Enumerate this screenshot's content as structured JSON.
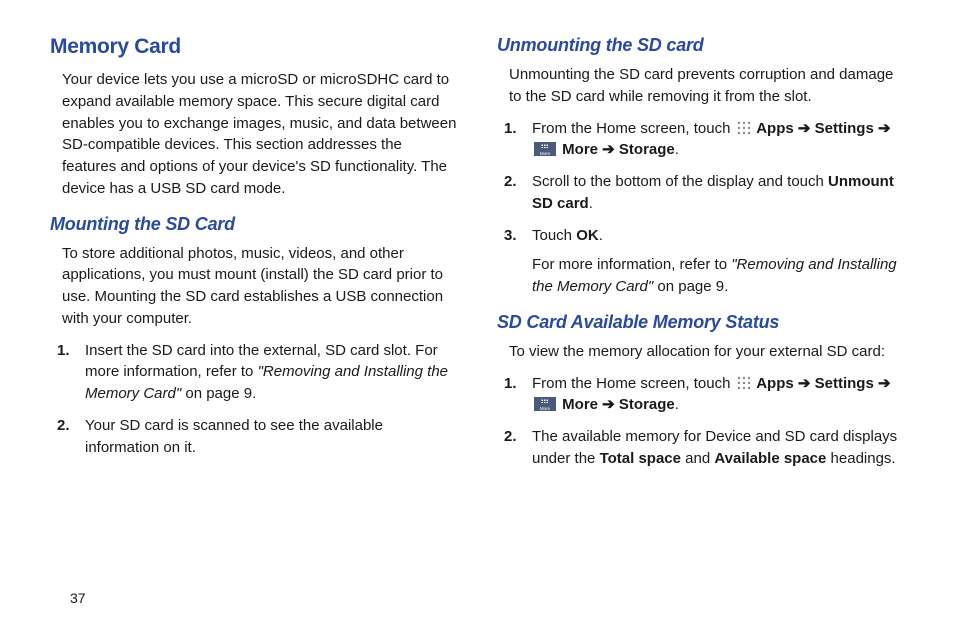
{
  "page_number": "37",
  "left": {
    "h1": "Memory Card",
    "intro": "Your device lets you use a microSD or microSDHC card to expand available memory space. This secure digital card enables you to exchange images, music, and data between SD-compatible devices. This section addresses the features and options of your device's SD functionality. The device has a USB SD card mode.",
    "h2_mount": "Mounting the SD Card",
    "mount_intro": "To store additional photos, music, videos, and other applications, you must mount (install) the SD card prior to use. Mounting the SD card establishes a USB connection with your computer.",
    "mount_steps": {
      "s1_a": "Insert the SD card into the external, SD card slot. For more information, refer to ",
      "s1_ref": "\"Removing and Installing the Memory Card\"",
      "s1_b": " on page 9.",
      "s2": "Your SD card is scanned to see the available information on it."
    }
  },
  "right": {
    "h2_unmount": "Unmounting the SD card",
    "unmount_intro": "Unmounting the SD card prevents corruption and damage to the SD card while removing it from the slot.",
    "unmount_steps": {
      "s1_a": "From the Home screen, touch ",
      "apps": " Apps ➔ Settings ➔ ",
      "more_storage": " More ➔ Storage",
      "period": ".",
      "s2_a": "Scroll to the bottom of the display and touch ",
      "s2_b": "Unmount SD card",
      "s3_a": "Touch ",
      "s3_b": "OK",
      "s3_c": ".",
      "s3_sub_a": "For more information, refer to ",
      "s3_sub_ref": "\"Removing and Installing the Memory Card\"",
      "s3_sub_b": " on page 9."
    },
    "h2_status": "SD Card Available Memory Status",
    "status_intro": "To view the memory allocation for your external SD card:",
    "status_steps": {
      "s1_a": "From the Home screen, touch ",
      "apps": " Apps ➔ Settings ➔ ",
      "more_storage": " More ➔ Storage",
      "period": ".",
      "s2_a": "The available memory for Device and SD card displays under the ",
      "s2_b": "Total space",
      "s2_c": " and ",
      "s2_d": "Available space",
      "s2_e": " headings."
    }
  },
  "nums": {
    "n1": "1.",
    "n2": "2.",
    "n3": "3."
  }
}
